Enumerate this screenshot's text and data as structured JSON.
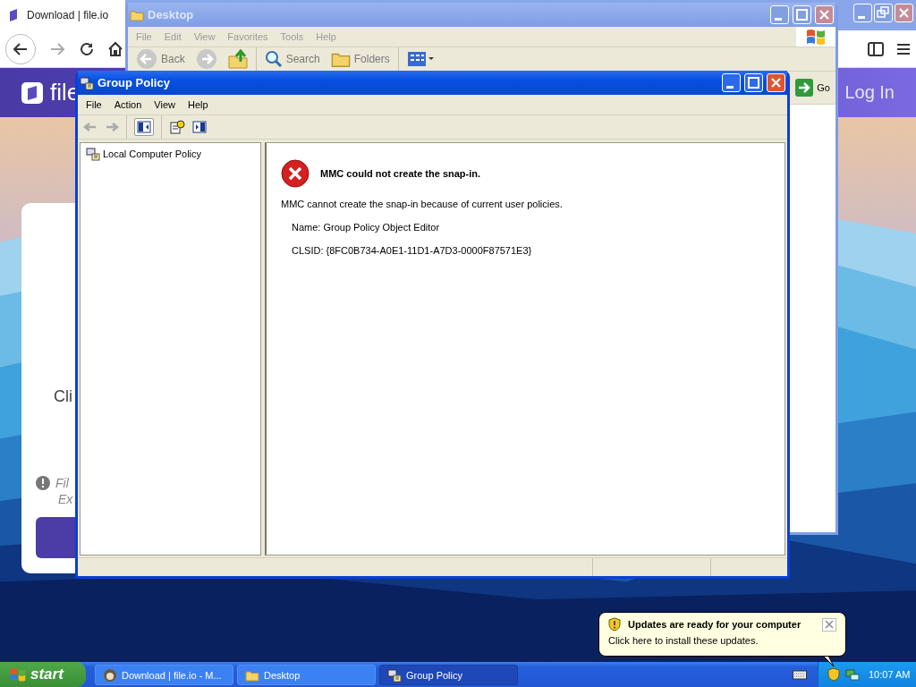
{
  "browser": {
    "tab_title": "Download | file.io",
    "logo_text": "file",
    "login": "Log In",
    "card_heading": "Cli",
    "note_lines": [
      "Fil",
      "Ex"
    ]
  },
  "explorer": {
    "title": "Desktop",
    "active": false,
    "menu": [
      "File",
      "Edit",
      "View",
      "Favorites",
      "Tools",
      "Help"
    ],
    "toolbar": [
      {
        "kind": "back",
        "label": "Back"
      },
      {
        "kind": "forward"
      },
      {
        "kind": "up"
      },
      {
        "kind": "search",
        "label": "Search"
      },
      {
        "kind": "folders",
        "label": "Folders"
      },
      {
        "kind": "views"
      }
    ],
    "go": "Go"
  },
  "group_policy": {
    "title": "Group Policy",
    "active": true,
    "menu": [
      "File",
      "Action",
      "View",
      "Help"
    ],
    "tree": [
      {
        "label": "Local Computer Policy",
        "selected": false
      }
    ],
    "error": {
      "heading": "MMC could not create the snap-in.",
      "message": "MMC cannot create the snap-in because of current user policies.",
      "details": [
        "Name: Group Policy Object Editor",
        "CLSID: {8FC0B734-A0E1-11D1-A7D3-0000F87571E3}"
      ]
    }
  },
  "balloon": {
    "title": "Updates are ready for your computer",
    "text": "Click here to install these updates."
  },
  "taskbar": {
    "start": "start",
    "buttons": [
      {
        "kind": "browser",
        "label": "Download | file.io - M...",
        "selected": false
      },
      {
        "kind": "folder",
        "label": "Desktop",
        "selected": false
      },
      {
        "kind": "policy",
        "label": "Group Policy",
        "selected": true
      }
    ],
    "clock": "10:07 AM"
  }
}
